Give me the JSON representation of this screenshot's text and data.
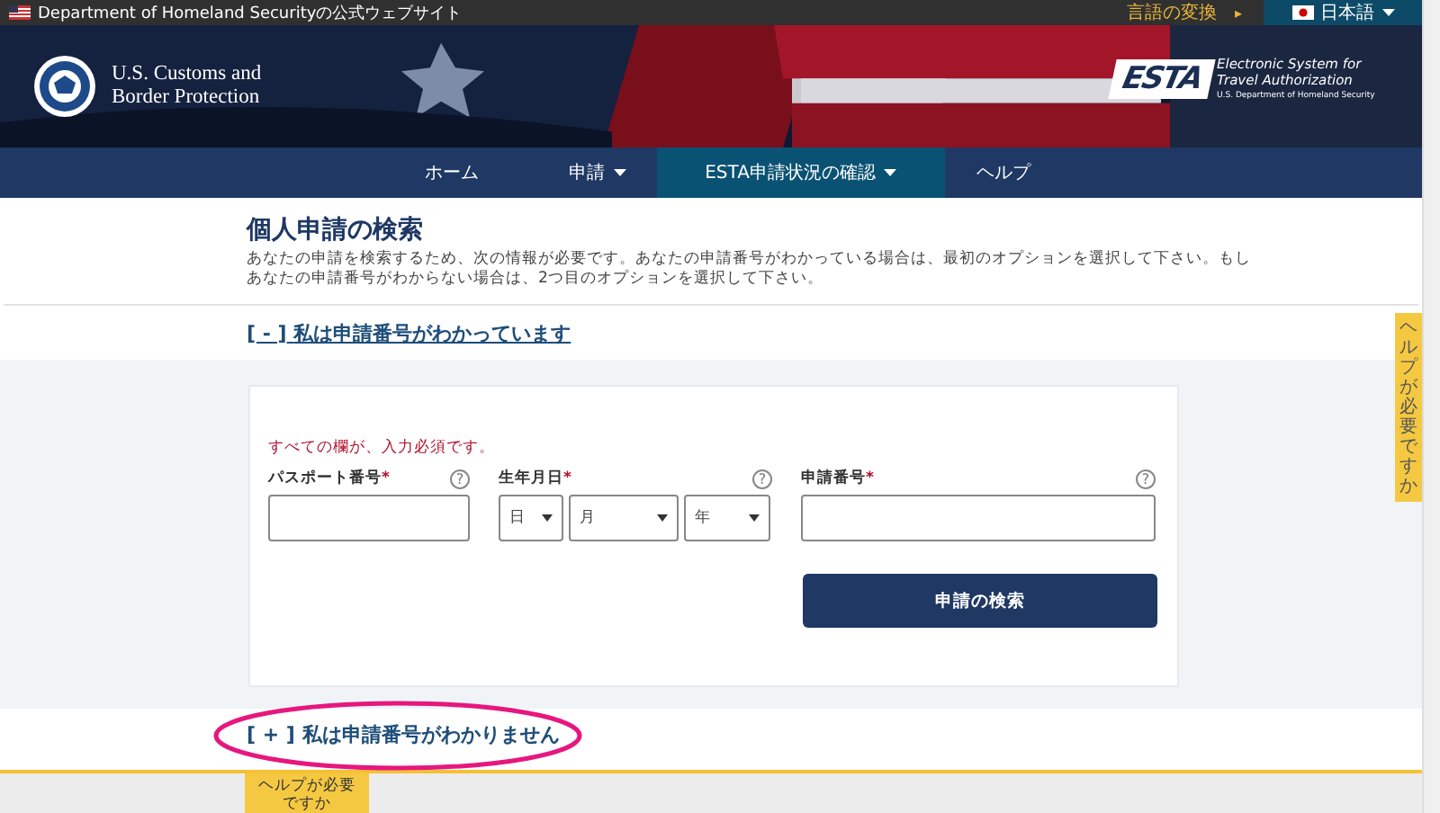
{
  "top_bar": {
    "site_label": "Department of Homeland Securityの公式ウェブサイト",
    "language_link": "言語の変換",
    "language_arrow": "▸",
    "language_button": "日本語"
  },
  "header": {
    "agency_name": "U.S. Customs and Border Protection",
    "esta_logo": "ESTA",
    "esta_name": "Electronic System for Travel Authorization",
    "esta_department": "U.S. Department of Homeland Security"
  },
  "nav": [
    {
      "label": "ホーム",
      "dropdown": false,
      "selected": false
    },
    {
      "label": "申請",
      "dropdown": true,
      "selected": false
    },
    {
      "label": "ESTA申請状況の確認",
      "dropdown": true,
      "selected": true
    },
    {
      "label": "ヘルプ",
      "dropdown": false,
      "selected": false
    }
  ],
  "page": {
    "title": "個人申請の検索",
    "intro": "あなたの申請を検索するため、次の情報が必要です。あなたの申請番号がわかっている場合は、最初のオプションを選択して下さい。もしあなたの申請番号がわからない場合は、2つ目のオプションを選択して下さい。"
  },
  "sections": [
    {
      "marker": "[ - ]",
      "label": "私は申請番号がわかっています",
      "expanded": true,
      "highlighted": false
    },
    {
      "marker": "[ + ]",
      "label": "私は申請番号がわかりません",
      "expanded": false,
      "highlighted": true
    }
  ],
  "form": {
    "notice": "すべての欄が、入力必須です。",
    "required_mark": "*",
    "fields": [
      {
        "kind": "text",
        "label": "パスポート番号"
      },
      {
        "kind": "date",
        "label": "生年月日",
        "selects": [
          "日",
          "月",
          "年"
        ]
      },
      {
        "kind": "text",
        "label": "申請番号"
      }
    ],
    "help_glyph": "?",
    "button": "申請の検索"
  },
  "help_tab_side": "ヘルプが必要ですか",
  "help_tab_bottom": [
    "ヘルプが必要",
    "ですか"
  ]
}
